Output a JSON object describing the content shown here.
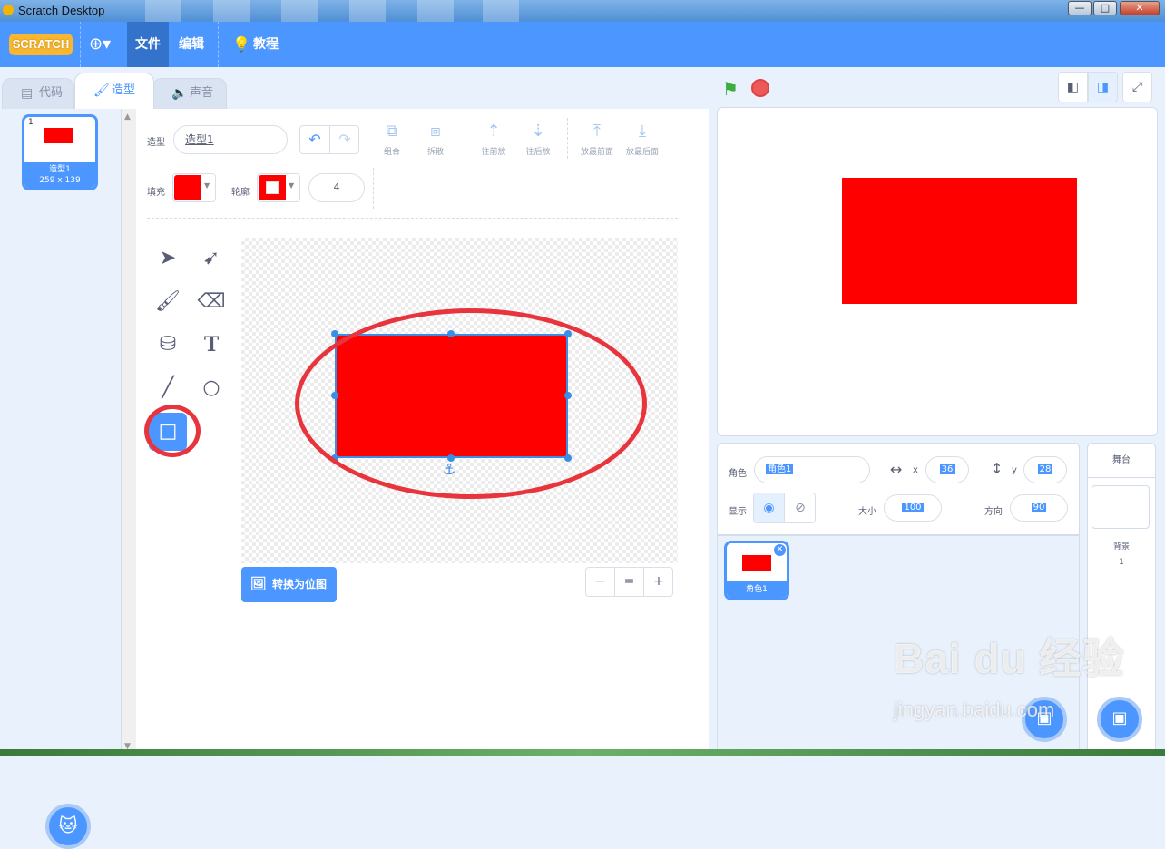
{
  "window": {
    "title": "Scratch Desktop",
    "minimize": "—",
    "maximize": "□",
    "close": "✕"
  },
  "menubar": {
    "logo": "SCRATCH",
    "language": "⊕▾",
    "file": "文件",
    "edit": "编辑",
    "tutorials": "教程"
  },
  "tabs": {
    "code": "代码",
    "costumes": "造型",
    "sounds": "声音"
  },
  "costume_list": {
    "items": [
      {
        "index": "1",
        "name": "造型1",
        "size": "259 x 139"
      }
    ]
  },
  "editor": {
    "costume_label": "造型",
    "costume_name": "造型1",
    "group": "组合",
    "ungroup": "拆散",
    "forward": "往前放",
    "backward": "往后放",
    "front": "放最前面",
    "back": "放最后面",
    "fill_label": "填充",
    "outline_label": "轮廓",
    "outline_width": "4",
    "fill_color": "#ff0000",
    "convert_button": "转换为位图",
    "zoom_out": "−",
    "zoom_reset": "=",
    "zoom_in": "+"
  },
  "stage": {
    "rect_color": "#ff0000"
  },
  "sprite_info": {
    "sprite_label": "角色",
    "sprite_name": "角色1",
    "x_label": "x",
    "x_value": "36",
    "y_label": "y",
    "y_value": "28",
    "show_label": "显示",
    "size_label": "大小",
    "size_value": "100",
    "direction_label": "方向",
    "direction_value": "90"
  },
  "sprites": [
    {
      "name": "角色1"
    }
  ],
  "stage_pane": {
    "title": "舞台",
    "backdrops_label": "背景",
    "backdrops_count": "1"
  },
  "watermark": {
    "brand": "Bai du 经验",
    "url": "jingyan.baidu.com"
  },
  "accent_color": "#4c97ff",
  "annotation_color": "#e8343c"
}
